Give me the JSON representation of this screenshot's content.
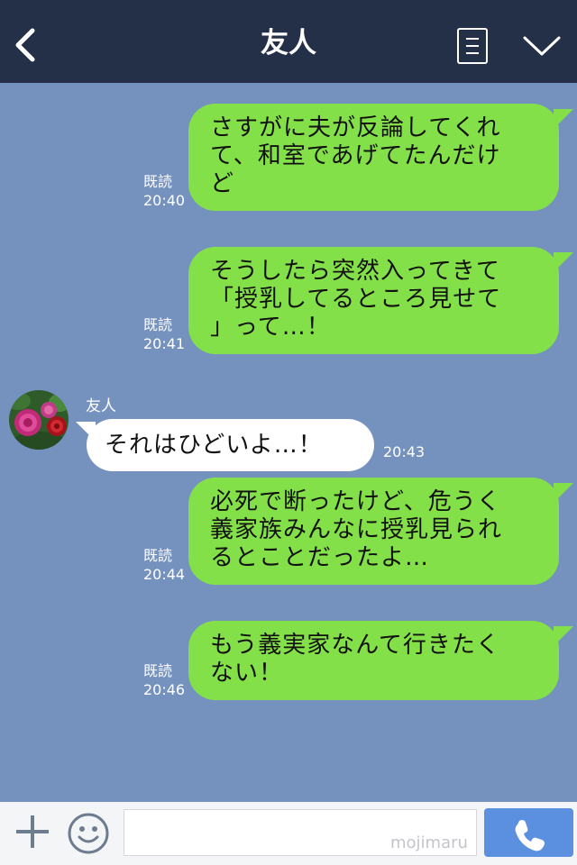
{
  "header": {
    "title": "友人",
    "back_icon": "chevron-left-icon",
    "menu_icon": "notes-menu-icon",
    "collapse_icon": "chevron-down-icon",
    "bg_color": "#243047"
  },
  "chat": {
    "bg_color": "#7592be",
    "outgoing_bubble_color": "#84e048",
    "incoming_bubble_color": "#ffffff",
    "messages": [
      {
        "direction": "out",
        "lines": [
          "さすがに夫が反論してくれ",
          "て、和室であげてたんだけ",
          "ど"
        ],
        "read_label": "既読",
        "time": "20:40"
      },
      {
        "direction": "out",
        "lines": [
          "そうしたら突然入ってきて",
          "「授乳してるところ見せて",
          "」って…！"
        ],
        "read_label": "既読",
        "time": "20:41"
      },
      {
        "direction": "in",
        "sender": "友人",
        "avatar_icon": "rose-avatar-icon",
        "lines": [
          "それはひどいよ…！"
        ],
        "time": "20:43"
      },
      {
        "direction": "out",
        "lines": [
          "必死で断ったけど、危うく",
          "義家族みんなに授乳見られ",
          "るとことだったよ…"
        ],
        "read_label": "既読",
        "time": "20:44"
      },
      {
        "direction": "out",
        "lines": [
          "もう義実家なんて行きたく",
          "ない！"
        ],
        "read_label": "既読",
        "time": "20:46"
      }
    ]
  },
  "footer": {
    "plus_icon": "plus-icon",
    "emoji_icon": "smiley-icon",
    "input_value": "",
    "watermark": "mojimaru",
    "call_icon": "phone-icon",
    "call_color": "#5b8fe0"
  }
}
